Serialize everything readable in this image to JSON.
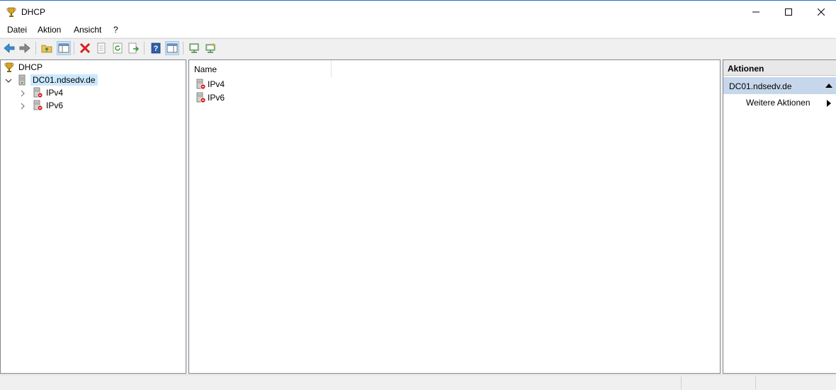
{
  "window": {
    "title": "DHCP",
    "accent_color": "#2b78d4",
    "icon": "dhcp-trophy-icon"
  },
  "menu": {
    "items": [
      "Datei",
      "Aktion",
      "Ansicht",
      "?"
    ]
  },
  "toolbar": {
    "icons": [
      "back-arrow-icon",
      "forward-arrow-icon",
      "up-folder-icon",
      "show-hide-tree-icon",
      "delete-icon",
      "properties-icon",
      "refresh-icon",
      "export-list-icon",
      "help-icon",
      "show-hide-action-pane-icon",
      "server-monitor-icon",
      "add-server-icon"
    ]
  },
  "tree": {
    "root": "DHCP",
    "server": "DC01.ndsedv.de",
    "children": [
      "IPv4",
      "IPv6"
    ]
  },
  "list": {
    "column_name": "Name",
    "items": [
      "IPv4",
      "IPv6"
    ]
  },
  "actions": {
    "header": "Aktionen",
    "section": "DC01.ndsedv.de",
    "item": "Weitere Aktionen"
  }
}
